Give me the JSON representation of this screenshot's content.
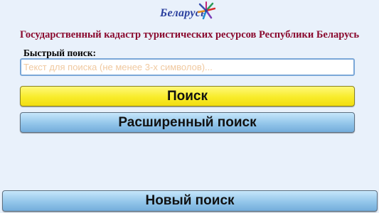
{
  "logo": {
    "text": "Беларусь"
  },
  "header": {
    "title": "Государственный кадастр туристических ресурсов Республики Беларусь"
  },
  "search": {
    "label": "Быстрый поиск:",
    "value": "",
    "placeholder": "Текст для поиска (не менее 3-х символов)..."
  },
  "buttons": {
    "search_label": "Поиск",
    "advanced_label": "Расширенный поиск",
    "new_label": "Новый поиск"
  },
  "colors": {
    "title": "#8a0a2e",
    "search_button": "#f8ec2a",
    "secondary_button": "#93c6ea",
    "background": "#e9f1fb"
  }
}
